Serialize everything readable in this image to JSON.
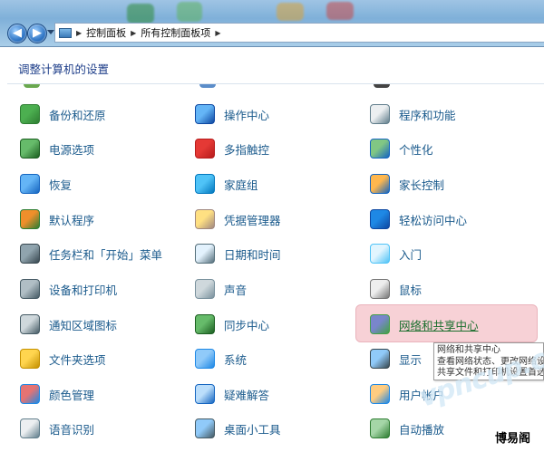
{
  "address_bar": {
    "crumbs": [
      "控制面板",
      "所有控制面板项"
    ]
  },
  "heading": "调整计算机的设置",
  "columns": [
    [
      {
        "label": "备份和还原",
        "icon": "backup-icon"
      },
      {
        "label": "电源选项",
        "icon": "power-icon"
      },
      {
        "label": "恢复",
        "icon": "recovery-icon"
      },
      {
        "label": "默认程序",
        "icon": "default-programs-icon"
      },
      {
        "label": "任务栏和「开始」菜单",
        "icon": "taskbar-icon"
      },
      {
        "label": "设备和打印机",
        "icon": "printer-icon"
      },
      {
        "label": "通知区域图标",
        "icon": "notification-icon"
      },
      {
        "label": "文件夹选项",
        "icon": "folder-icon"
      },
      {
        "label": "颜色管理",
        "icon": "color-icon"
      },
      {
        "label": "语音识别",
        "icon": "microphone-icon"
      }
    ],
    [
      {
        "label": "操作中心",
        "icon": "flag-icon"
      },
      {
        "label": "多指触控",
        "icon": "touch-icon"
      },
      {
        "label": "家庭组",
        "icon": "homegroup-icon"
      },
      {
        "label": "凭据管理器",
        "icon": "credential-icon"
      },
      {
        "label": "日期和时间",
        "icon": "clock-icon"
      },
      {
        "label": "声音",
        "icon": "speaker-icon"
      },
      {
        "label": "同步中心",
        "icon": "sync-icon"
      },
      {
        "label": "系统",
        "icon": "system-icon"
      },
      {
        "label": "疑难解答",
        "icon": "troubleshoot-icon"
      },
      {
        "label": "桌面小工具",
        "icon": "gadgets-icon"
      }
    ],
    [
      {
        "label": "程序和功能",
        "icon": "programs-icon"
      },
      {
        "label": "个性化",
        "icon": "personalize-icon"
      },
      {
        "label": "家长控制",
        "icon": "parental-icon"
      },
      {
        "label": "轻松访问中心",
        "icon": "accessibility-icon"
      },
      {
        "label": "入门",
        "icon": "getting-started-icon"
      },
      {
        "label": "鼠标",
        "icon": "mouse-icon"
      },
      {
        "label": "网络和共享中心",
        "icon": "network-icon"
      },
      {
        "label": "显示",
        "icon": "display-icon"
      },
      {
        "label": "用户帐户",
        "icon": "user-icon"
      },
      {
        "label": "自动播放",
        "icon": "autoplay-icon"
      }
    ]
  ],
  "tooltip": {
    "lines": [
      "网络和共享中心",
      "查看网络状态、更改网络设置",
      "共享文件和打印机设置首选项"
    ]
  },
  "watermark": "vpncup.com",
  "brand": "博易阁",
  "colors": {
    "link": "#1a5a8c",
    "heading": "#1f3f8a",
    "highlight": "#f7d1d6"
  }
}
